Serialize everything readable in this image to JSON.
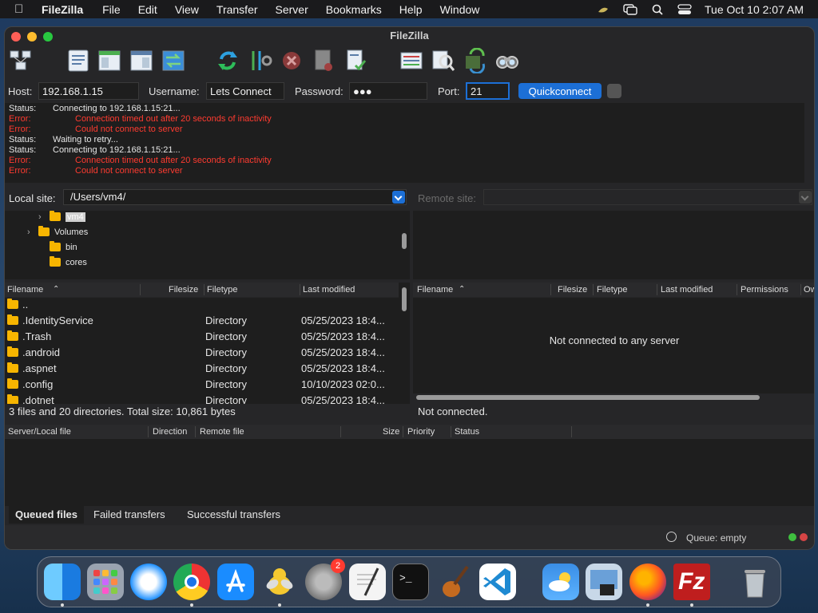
{
  "menubar": {
    "app_name": "FileZilla",
    "items": [
      "File",
      "Edit",
      "View",
      "Transfer",
      "Server",
      "Bookmarks",
      "Help",
      "Window"
    ],
    "clock": "Tue Oct 10  2:07 AM"
  },
  "window": {
    "title": "FileZilla"
  },
  "quickconnect": {
    "host_label": "Host:",
    "host_value": "192.168.1.15",
    "username_label": "Username:",
    "username_value": "Lets Connect",
    "password_label": "Password:",
    "password_value": "●●●",
    "port_label": "Port:",
    "port_value": "21",
    "button_label": "Quickconnect"
  },
  "log": [
    {
      "type": "status",
      "label": "Status:",
      "message": "Connecting to 192.168.1.15:21..."
    },
    {
      "type": "error",
      "label": "Error:",
      "message": "Connection timed out after 20 seconds of inactivity"
    },
    {
      "type": "error",
      "label": "Error:",
      "message": "Could not connect to server"
    },
    {
      "type": "status",
      "label": "Status:",
      "message": "Waiting to retry..."
    },
    {
      "type": "status",
      "label": "Status:",
      "message": "Connecting to 192.168.1.15:21..."
    },
    {
      "type": "error",
      "label": "Error:",
      "message": "Connection timed out after 20 seconds of inactivity"
    },
    {
      "type": "error",
      "label": "Error:",
      "message": "Could not connect to server"
    }
  ],
  "local_site": {
    "label": "Local site:",
    "path": "/Users/vm4/"
  },
  "remote_site": {
    "label": "Remote site:",
    "path": ""
  },
  "local_tree": [
    {
      "name": "vm4",
      "selected": true,
      "expandable": true
    },
    {
      "name": "Volumes",
      "selected": false,
      "expandable": true
    },
    {
      "name": "bin",
      "selected": false,
      "expandable": false
    },
    {
      "name": "cores",
      "selected": false,
      "expandable": false
    }
  ],
  "local_columns": [
    "Filename",
    "Filesize",
    "Filetype",
    "Last modified"
  ],
  "local_files": [
    {
      "name": "..",
      "type": "",
      "modified": ""
    },
    {
      "name": ".IdentityService",
      "type": "Directory",
      "modified": "05/25/2023 18:4..."
    },
    {
      "name": ".Trash",
      "type": "Directory",
      "modified": "05/25/2023 18:4..."
    },
    {
      "name": ".android",
      "type": "Directory",
      "modified": "05/25/2023 18:4..."
    },
    {
      "name": ".aspnet",
      "type": "Directory",
      "modified": "05/25/2023 18:4..."
    },
    {
      "name": ".config",
      "type": "Directory",
      "modified": "10/10/2023 02:0..."
    },
    {
      "name": ".dotnet",
      "type": "Directory",
      "modified": "05/25/2023 18:4..."
    }
  ],
  "remote_columns": [
    "Filename",
    "Filesize",
    "Filetype",
    "Last modified",
    "Permissions",
    "Ow"
  ],
  "remote_empty_message": "Not connected to any server",
  "local_status": "3 files and 20 directories. Total size: 10,861 bytes",
  "remote_status": "Not connected.",
  "queue_columns": [
    "Server/Local file",
    "Direction",
    "Remote file",
    "Size",
    "Priority",
    "Status"
  ],
  "queue_tabs": [
    "Queued files",
    "Failed transfers",
    "Successful transfers"
  ],
  "queue_status": "Queue: empty",
  "dock": {
    "settings_badge": "2",
    "apps": [
      "finder-icon",
      "launchpad-icon",
      "safari-icon",
      "chrome-icon",
      "app-store-icon",
      "cyberduck-icon",
      "system-settings-icon",
      "textedit-icon",
      "terminal-icon",
      "garageband-icon",
      "vscode-icon",
      "weather-icon",
      "preview-icon",
      "firefox-icon",
      "filezilla-icon",
      "trash-icon"
    ]
  },
  "colors": {
    "accent": "#1c6fd6",
    "error": "#ff3b30",
    "folder": "#f7b500"
  }
}
